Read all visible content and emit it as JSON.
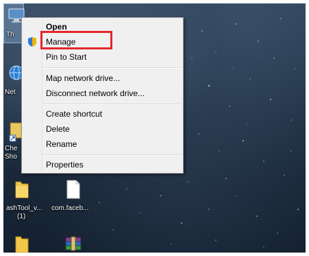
{
  "desktop": {
    "icons": [
      {
        "label": "Th",
        "icon": "this-pc-icon"
      },
      {
        "label": "Net",
        "icon": "network-icon"
      },
      {
        "label": "Che",
        "icon": "shortcut-icon"
      },
      {
        "label": "Sho",
        "icon": "shortcut-icon"
      },
      {
        "label": "ashTool_v...",
        "icon": "folder-icon"
      },
      {
        "label": "(1)",
        "icon": "folder-icon"
      },
      {
        "label": "com.faceb...",
        "icon": "file-icon"
      }
    ]
  },
  "context_menu": {
    "items": [
      {
        "label": "Open",
        "bold": true
      },
      {
        "label": "Manage",
        "icon": "shield-icon"
      },
      {
        "label": "Pin to Start"
      },
      {
        "label": "Map network drive..."
      },
      {
        "label": "Disconnect network drive..."
      },
      {
        "label": "Create shortcut"
      },
      {
        "label": "Delete"
      },
      {
        "label": "Rename"
      },
      {
        "label": "Properties"
      }
    ]
  },
  "annotation": {
    "color": "#e3262b",
    "highlights": "Manage"
  }
}
